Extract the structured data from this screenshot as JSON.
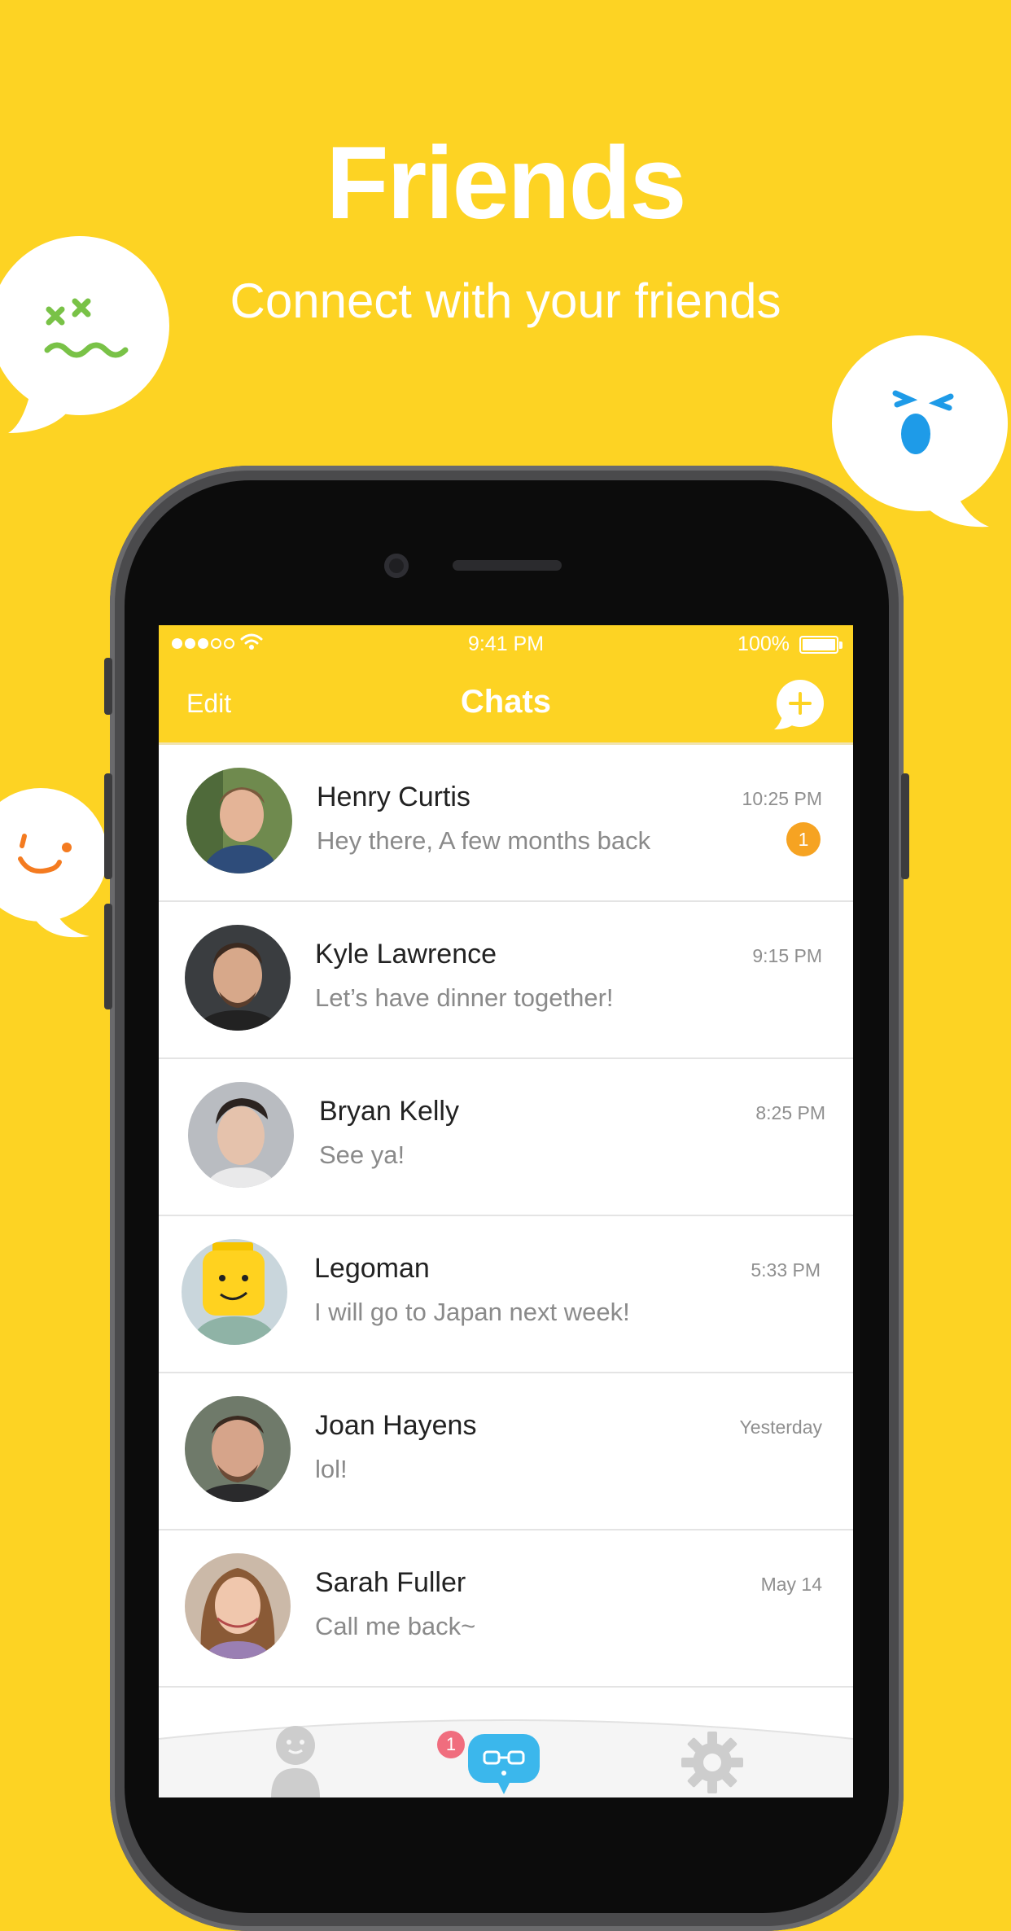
{
  "hero": {
    "title": "Friends",
    "subtitle": "Connect with your friends"
  },
  "status_bar": {
    "time": "9:41 PM",
    "battery": "100%"
  },
  "nav": {
    "edit_label": "Edit",
    "title": "Chats",
    "add_icon": "plus-bubble-icon"
  },
  "colors": {
    "brand_yellow": "#FDD323",
    "badge_orange": "#F6A322",
    "accent_blue": "#3BB7EC",
    "badge_red": "#F06D7E"
  },
  "chats": [
    {
      "name": "Henry Curtis",
      "message": "Hey there, A few months back",
      "time": "10:25 PM",
      "unread": "1"
    },
    {
      "name": "Kyle Lawrence",
      "message": "Let’s have dinner together!",
      "time": "9:15 PM"
    },
    {
      "name": "Bryan Kelly",
      "message": "See ya!",
      "time": "8:25 PM"
    },
    {
      "name": "Legoman",
      "message": "I will go to Japan next week!",
      "time": "5:33 PM"
    },
    {
      "name": "Joan Hayens",
      "message": "lol!",
      "time": "Yesterday"
    },
    {
      "name": "Sarah Fuller",
      "message": "Call me back~",
      "time": "May 14"
    }
  ],
  "tabbar": {
    "tabs": [
      {
        "icon": "contacts-icon",
        "active": false
      },
      {
        "icon": "chats-icon",
        "active": true,
        "badge": "1"
      },
      {
        "icon": "settings-gear-icon",
        "active": false
      }
    ]
  }
}
